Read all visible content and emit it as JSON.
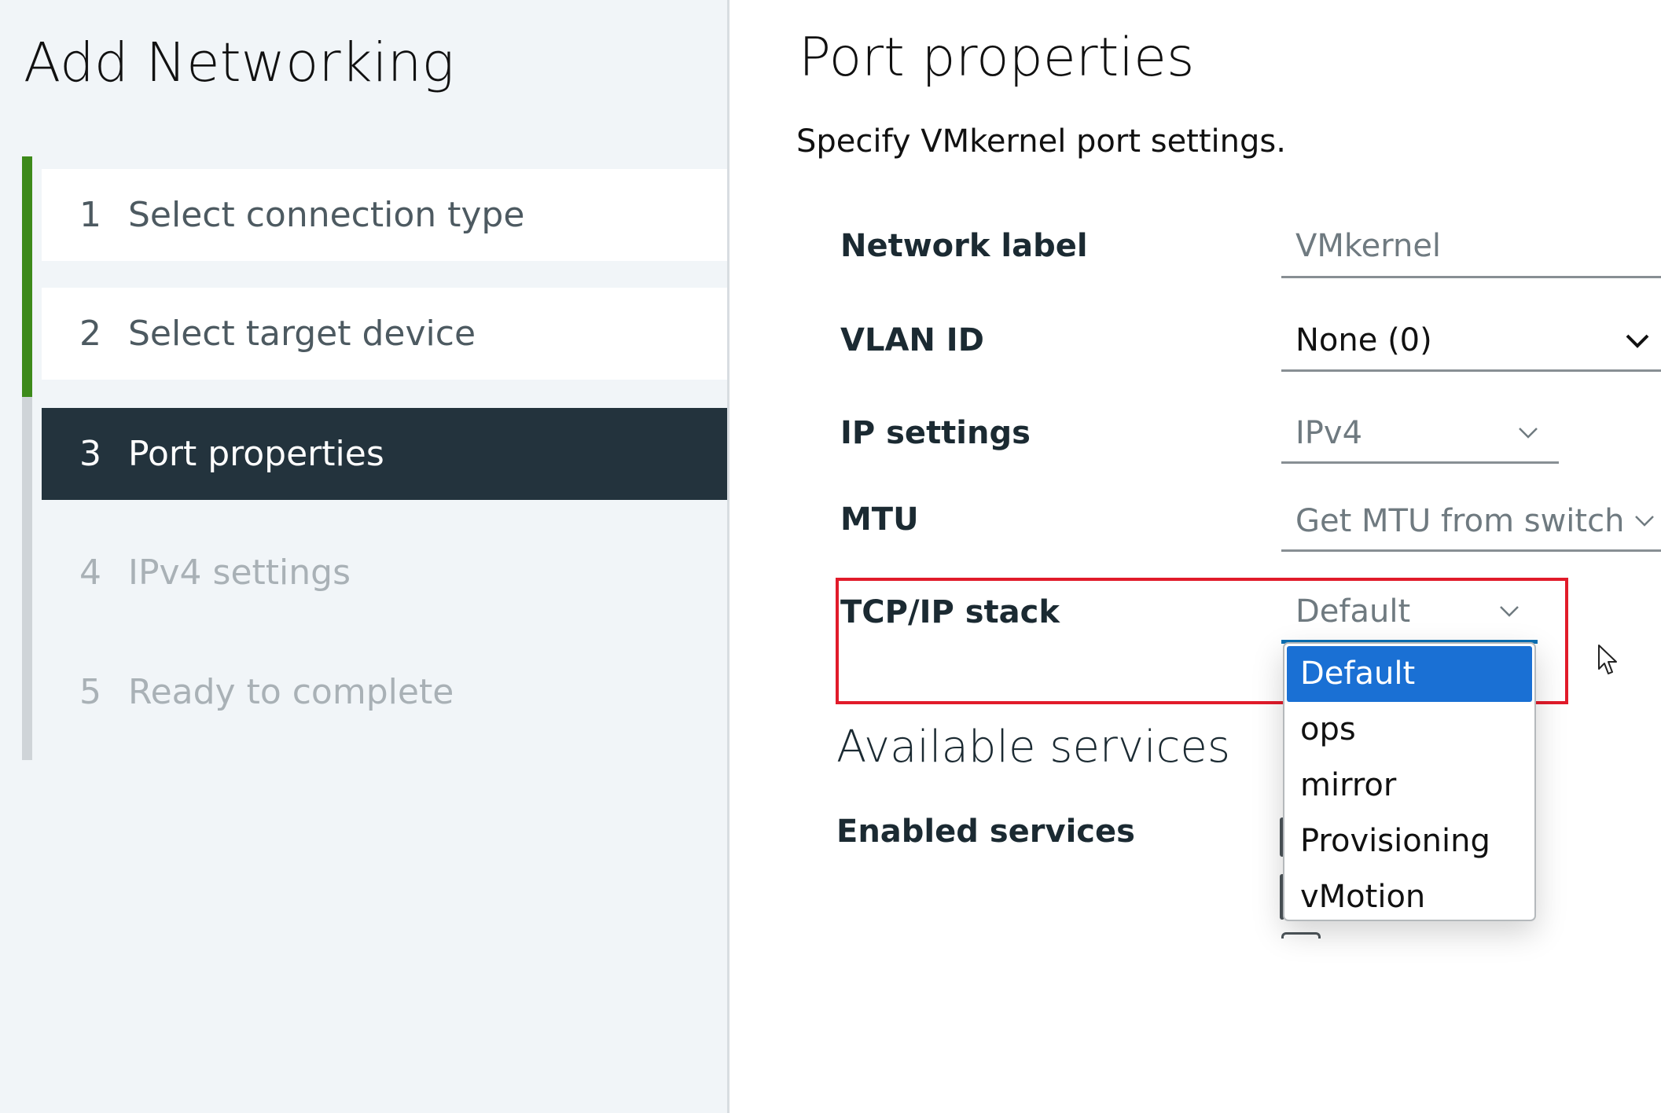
{
  "wizard": {
    "title": "Add Networking",
    "steps": [
      {
        "number": "1",
        "label": "Select connection type",
        "state": "complete"
      },
      {
        "number": "2",
        "label": "Select target device",
        "state": "complete"
      },
      {
        "number": "3",
        "label": "Port properties",
        "state": "current"
      },
      {
        "number": "4",
        "label": "IPv4 settings",
        "state": "pending"
      },
      {
        "number": "5",
        "label": "Ready to complete",
        "state": "pending"
      }
    ]
  },
  "page": {
    "title": "Port properties",
    "subtitle": "Specify VMkernel port settings."
  },
  "form": {
    "network_label": {
      "label": "Network label",
      "placeholder": "VMkernel"
    },
    "vlan_id": {
      "label": "VLAN ID",
      "value": "None (0)"
    },
    "ip_settings": {
      "label": "IP settings",
      "value": "IPv4"
    },
    "mtu": {
      "label": "MTU",
      "value": "Get MTU from switch"
    },
    "tcpip_stack": {
      "label": "TCP/IP stack",
      "value": "Default",
      "options": [
        "Default",
        "ops",
        "mirror",
        "Provisioning",
        "vMotion"
      ],
      "selected_option": "Default"
    }
  },
  "services": {
    "section_title": "Available services",
    "enabled_label": "Enabled services"
  },
  "colors": {
    "accent_green": "#3d8a1a",
    "current_step_bg": "#23333d",
    "selection_blue": "#1a70d4",
    "highlight_red": "#e11b2a",
    "focus_underline": "#0b6fb3"
  }
}
